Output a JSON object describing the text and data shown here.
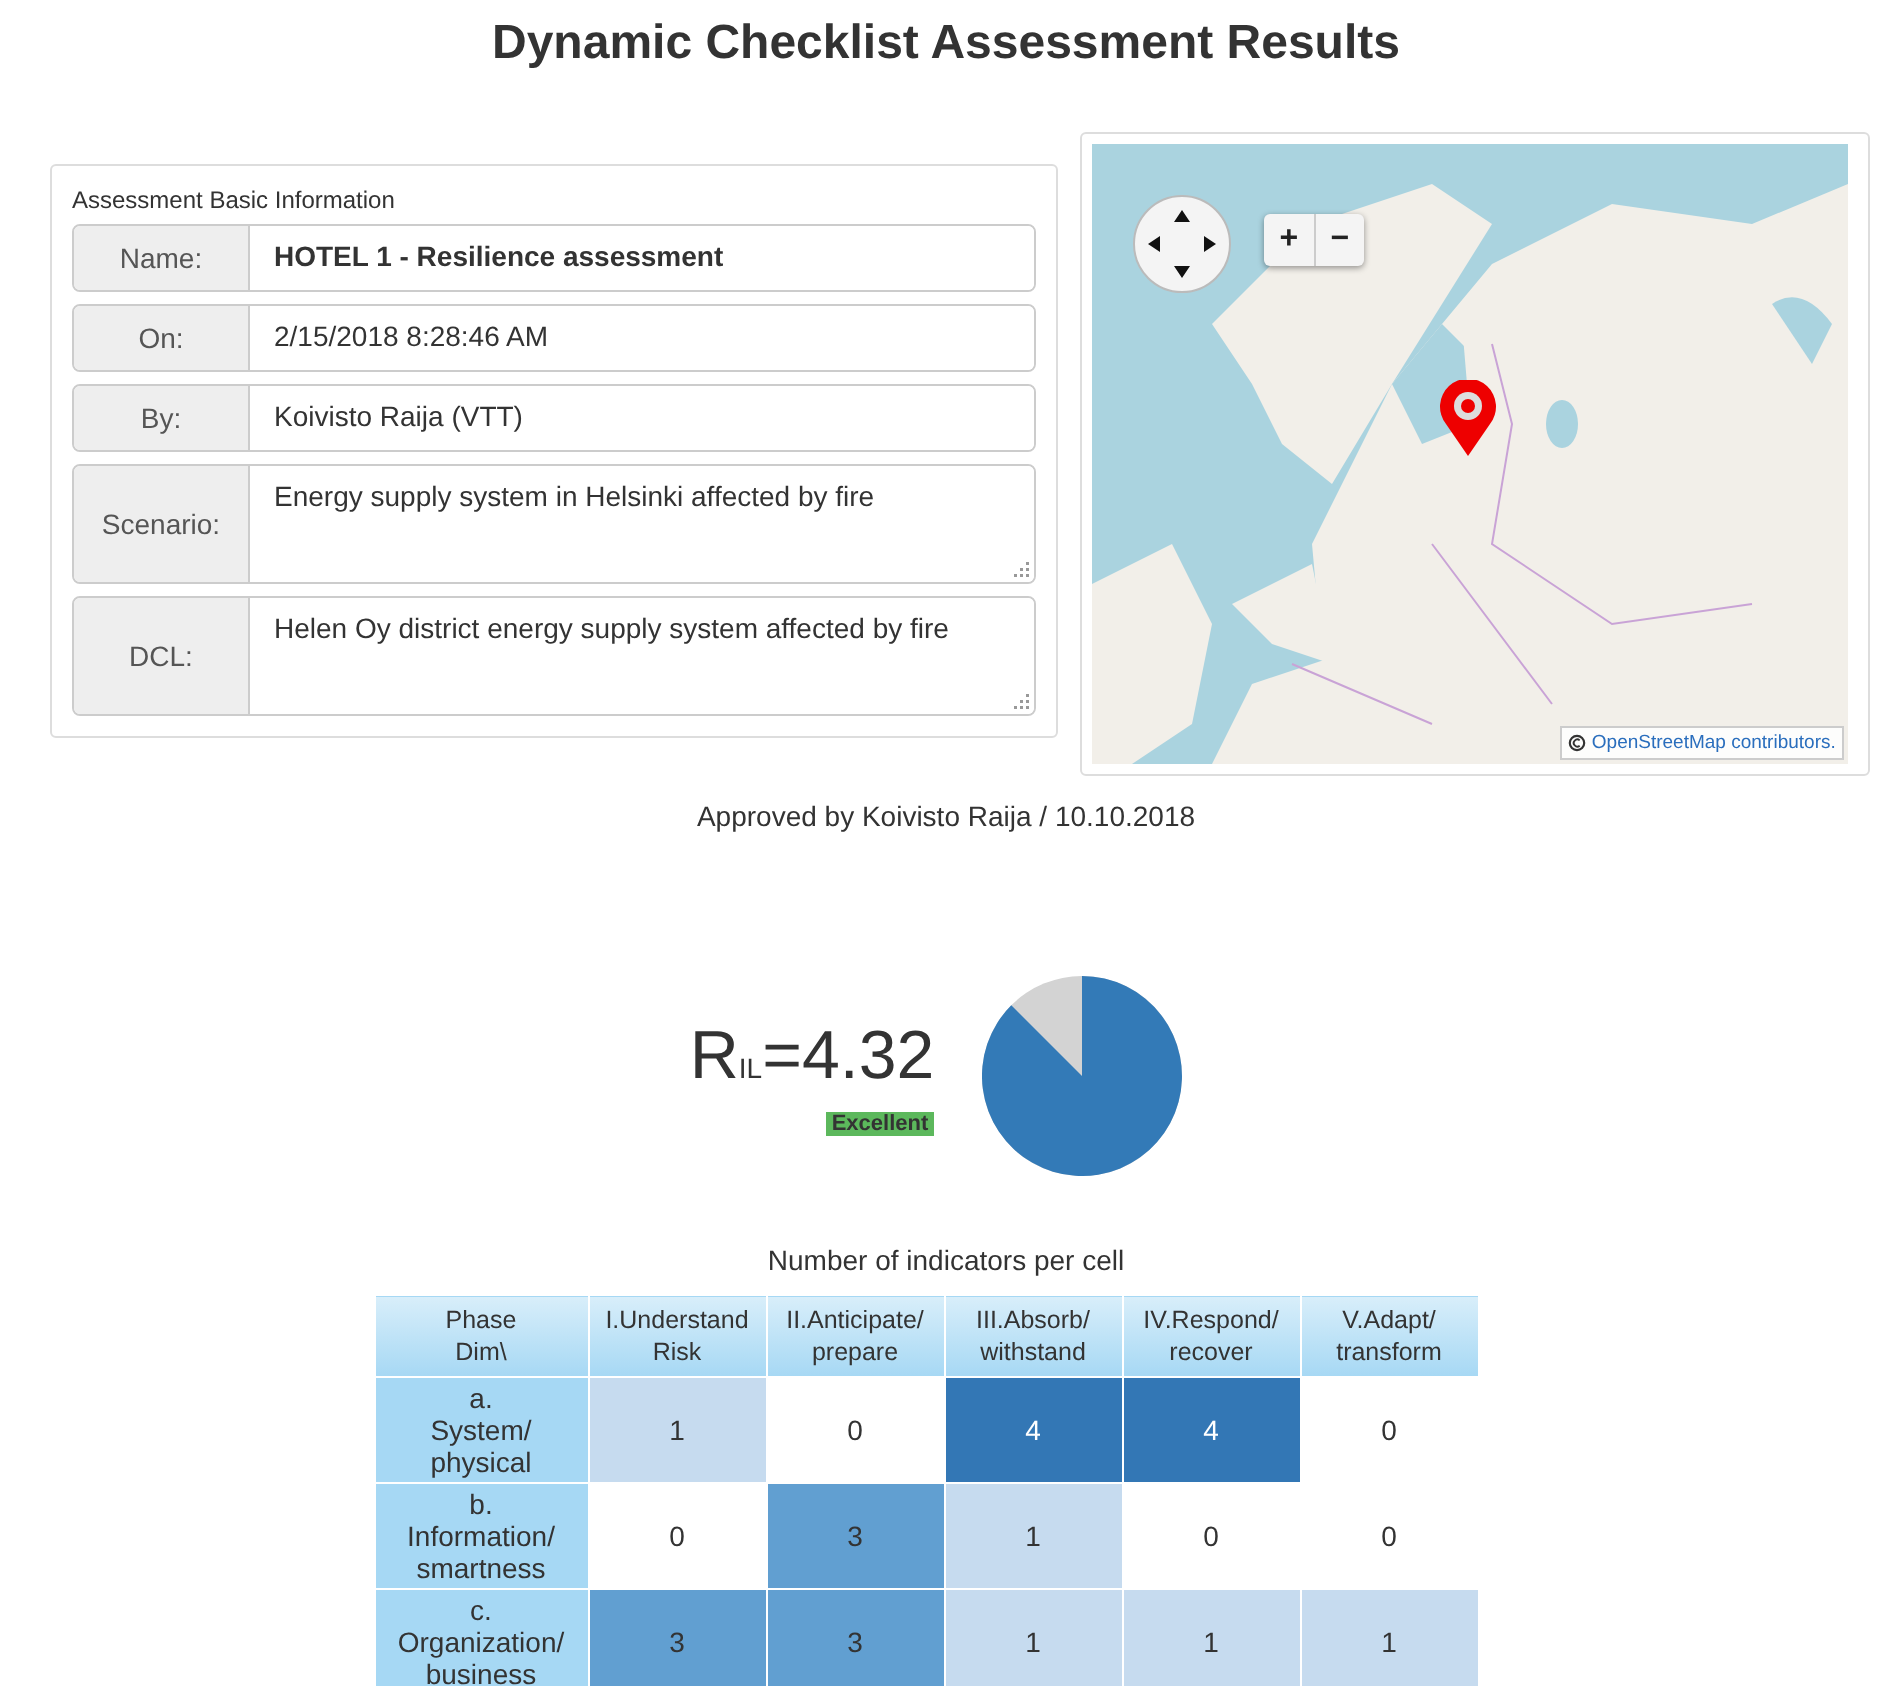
{
  "title": "Dynamic Checklist Assessment Results",
  "info": {
    "heading": "Assessment Basic Information",
    "fields": [
      {
        "label": "Name:",
        "value": "HOTEL 1 - Resilience assessment",
        "kind": "bold"
      },
      {
        "label": "On:",
        "value": "2/15/2018 8:28:46 AM",
        "kind": "line"
      },
      {
        "label": "By:",
        "value": "Koivisto Raija (VTT)",
        "kind": "line"
      },
      {
        "label": "Scenario:",
        "value": "Energy supply system in Helsinki affected by fire",
        "kind": "area"
      },
      {
        "label": "DCL:",
        "value": "Helen Oy district energy supply system affected by fire",
        "kind": "area"
      }
    ]
  },
  "map": {
    "kind": "picture",
    "zoom_in": "+",
    "zoom_out": "−",
    "attribution": "OpenStreetMap contributors."
  },
  "approval": "Approved by Koivisto Raija / 10.10.2018",
  "score": {
    "symbol": "R$_{IL}$=4.32",
    "rating": "Excellent"
  },
  "table": {
    "caption": "Number of indicators per cell",
    "corner": "Phase\nDim\\",
    "columns": [
      "I.Understand\nRisk",
      "II.Anticipate/\nprepare",
      "III.Absorb/\nwithstand",
      "IV.Respond/\nrecover",
      "V.Adapt/\ntransform"
    ],
    "rows": [
      {
        "header": "a.\nSystem/\nphysical",
        "cells": [
          "1",
          "0",
          "4",
          "4",
          "0"
        ]
      },
      {
        "header": "b.\nInformation/\nsmartness",
        "cells": [
          "0",
          "3",
          "1",
          "0",
          "0"
        ]
      },
      {
        "header": "c.\nOrganization/\nbusiness",
        "cells": [
          "3",
          "3",
          "1",
          "1",
          "1"
        ]
      }
    ]
  }
}
